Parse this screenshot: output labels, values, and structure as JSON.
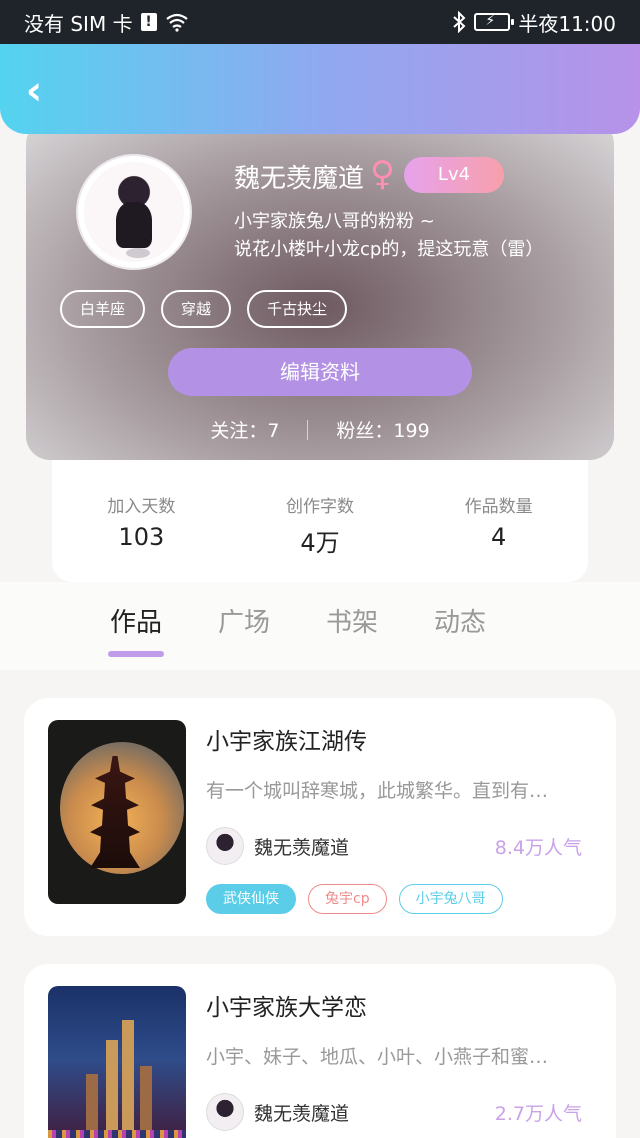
{
  "status_bar": {
    "carrier": "没有 SIM 卡",
    "sim_alert": "!",
    "time": "半夜11:00",
    "icons": [
      "wifi-icon",
      "bluetooth-icon",
      "battery-icon"
    ]
  },
  "header": {
    "back_icon": "‹"
  },
  "profile": {
    "nickname": "魏无羡魔道",
    "gender_icon": "♀",
    "level": "Lv4",
    "bio_line1": "小宇家族兔八哥的粉粉 ~",
    "bio_line2": "说花小楼叶小龙cp的，提这玩意（雷）",
    "tags": [
      "白羊座",
      "穿越",
      "千古抉尘"
    ],
    "edit_button": "编辑资料",
    "following": "关注：7",
    "followers": "粉丝：199"
  },
  "stats": [
    {
      "label": "加入天数",
      "value": "103"
    },
    {
      "label": "创作字数",
      "value": "4万"
    },
    {
      "label": "作品数量",
      "value": "4"
    }
  ],
  "tabs": [
    {
      "label": "作品",
      "active": true
    },
    {
      "label": "广场",
      "active": false
    },
    {
      "label": "书架",
      "active": false
    },
    {
      "label": "动态",
      "active": false
    }
  ],
  "works": [
    {
      "title": "小宇家族江湖传",
      "description": "有一个城叫辞寒城，此城繁华。直到有…",
      "author": "魏无羡魔道",
      "popularity": "8.4万人气",
      "tags": [
        "武侠仙侠",
        "兔宇cp",
        "小宇兔八哥"
      ]
    },
    {
      "title": "小宇家族大学恋",
      "description": "小宇、妹子、地瓜、小叶、小燕子和蜜…",
      "author": "魏无羡魔道",
      "popularity": "2.7万人气"
    }
  ],
  "colors": {
    "accent_purple": "#b391e4",
    "header_start": "#54d3ef",
    "header_end": "#b792e8",
    "popularity": "#c9a2e8",
    "tag_blue": "#5ccde8",
    "tag_red": "#ef8b8b"
  }
}
